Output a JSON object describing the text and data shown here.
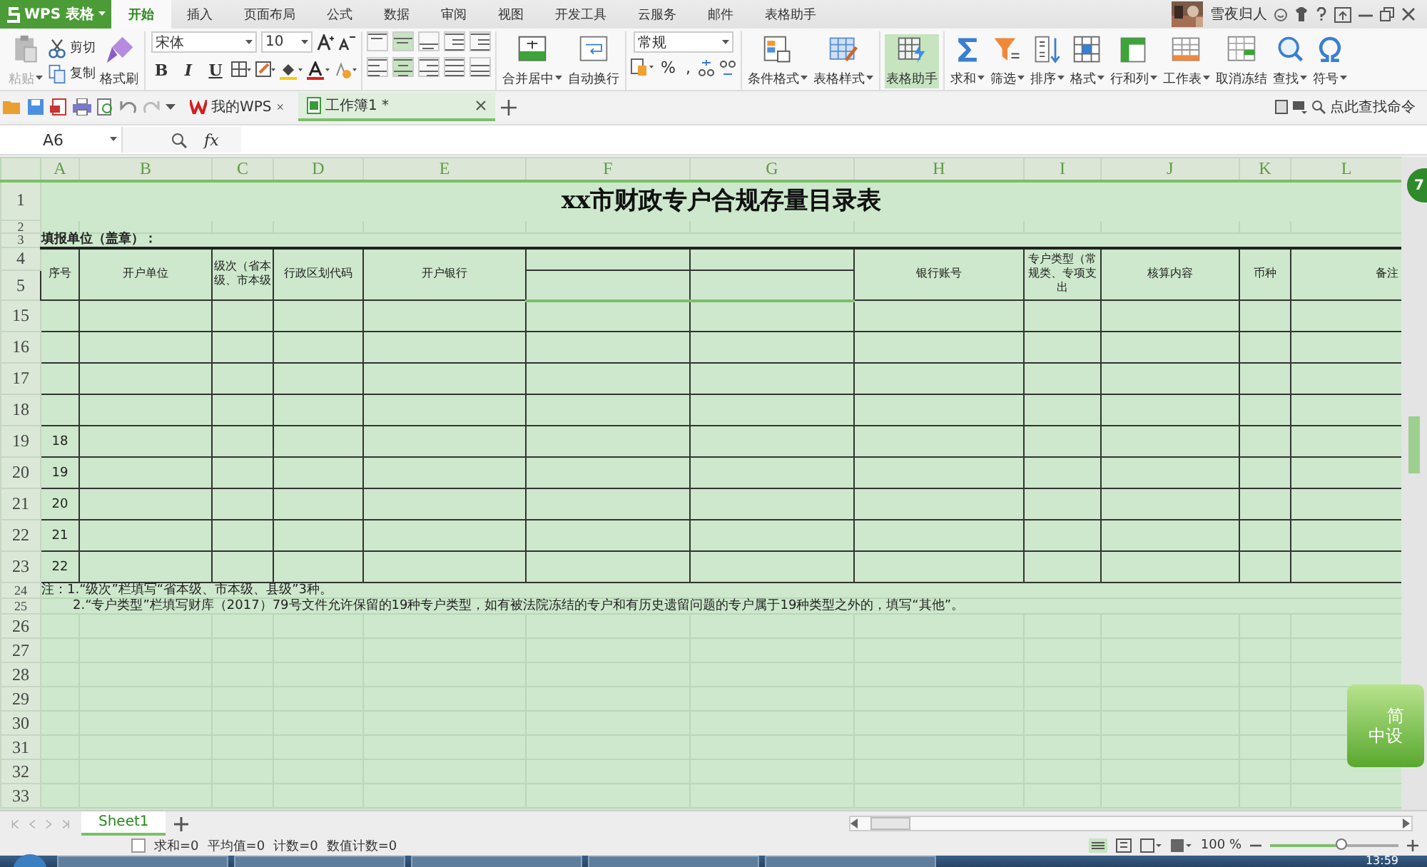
{
  "app": {
    "name": "WPS 表格"
  },
  "ribbon_tabs": [
    {
      "label": "开始",
      "selected": true
    },
    {
      "label": "插入",
      "selected": false
    },
    {
      "label": "页面布局",
      "selected": false
    },
    {
      "label": "公式",
      "selected": false
    },
    {
      "label": "数据",
      "selected": false
    },
    {
      "label": "审阅",
      "selected": false
    },
    {
      "label": "视图",
      "selected": false
    },
    {
      "label": "开发工具",
      "selected": false
    },
    {
      "label": "云服务",
      "selected": false
    },
    {
      "label": "邮件",
      "selected": false
    },
    {
      "label": "表格助手",
      "selected": false
    }
  ],
  "user": {
    "name": "雪夜归人"
  },
  "clipboard": [
    {
      "label": "粘贴",
      "disabled": true,
      "dropdown": true
    },
    {
      "label": "剪切",
      "disabled": false,
      "dropdown": false
    },
    {
      "label": "复制",
      "disabled": false,
      "dropdown": false
    },
    {
      "label": "格式刷",
      "disabled": false,
      "dropdown": false
    }
  ],
  "font": {
    "name": "宋体",
    "size": "10"
  },
  "text_styles": [
    "B",
    "I",
    "U"
  ],
  "align_buttons": [
    {
      "selected": false
    },
    {
      "selected": true
    },
    {
      "selected": false
    },
    {
      "selected": false
    },
    {
      "selected": false
    },
    {
      "selected": false
    },
    {
      "selected": true
    },
    {
      "selected": false
    },
    {
      "selected": false
    },
    {
      "selected": false
    }
  ],
  "merge_buttons": [
    {
      "label": "合并居中",
      "dropdown": true
    },
    {
      "label": "自动换行",
      "dropdown": false
    }
  ],
  "number_format": {
    "value": "常规",
    "symbols": [
      "%",
      ","
    ]
  },
  "large_buttons": [
    {
      "label": "条件格式",
      "dropdown": true,
      "selected": false
    },
    {
      "label": "表格样式",
      "dropdown": true,
      "selected": false
    },
    {
      "label": "表格助手",
      "dropdown": false,
      "selected": true
    },
    {
      "label": "求和",
      "dropdown": true,
      "selected": false
    },
    {
      "label": "筛选",
      "dropdown": true,
      "selected": false
    },
    {
      "label": "排序",
      "dropdown": true,
      "selected": false
    },
    {
      "label": "格式",
      "dropdown": true,
      "selected": false
    },
    {
      "label": "行和列",
      "dropdown": true,
      "selected": false
    },
    {
      "label": "工作表",
      "dropdown": true,
      "selected": false
    },
    {
      "label": "取消冻结",
      "dropdown": false,
      "selected": false
    },
    {
      "label": "查找",
      "dropdown": true,
      "selected": false
    },
    {
      "label": "符号",
      "dropdown": true,
      "selected": false
    }
  ],
  "doc_tabs": [
    {
      "label": "我的WPS",
      "kind": "home",
      "selected": false
    },
    {
      "label": "工作簿1 *",
      "kind": "sheet",
      "selected": true
    }
  ],
  "command_search": {
    "placeholder": "点此查找命令"
  },
  "name_box": {
    "value": "A6"
  },
  "formula_label": "fx",
  "columns": [
    "A",
    "B",
    "C",
    "D",
    "E",
    "F",
    "G",
    "H",
    "I",
    "J",
    "K",
    "L"
  ],
  "rows": [
    {
      "number": "1",
      "kind": "title",
      "text": "xx市财政专户合规存量目录表"
    },
    {
      "number": "2",
      "kind": "spacer"
    },
    {
      "number": "3",
      "kind": "unit",
      "text": "填报单位（盖章）："
    },
    {
      "numbers": [
        "4",
        "5"
      ],
      "kind": "header",
      "cells": [
        {
          "kind": "label",
          "text": "序号"
        },
        {
          "kind": "label",
          "text": "开户单位"
        },
        {
          "kind": "label",
          "text": "级次（省本级、市本级"
        },
        {
          "kind": "label",
          "text": "行政区划代码"
        },
        {
          "kind": "label",
          "text": "开户银行"
        },
        {
          "kind": "split"
        },
        {
          "kind": "split"
        },
        {
          "kind": "label",
          "text": "银行账号"
        },
        {
          "kind": "label",
          "text": "专户类型（常规类、专项支出"
        },
        {
          "kind": "label",
          "text": "核算内容"
        },
        {
          "kind": "label",
          "text": "币种"
        },
        {
          "kind": "label",
          "text": "备注"
        }
      ]
    },
    {
      "number": "15",
      "kind": "data"
    },
    {
      "number": "16",
      "kind": "data"
    },
    {
      "number": "17",
      "kind": "data"
    },
    {
      "number": "18",
      "kind": "data"
    },
    {
      "number": "19",
      "kind": "data",
      "serial": "18"
    },
    {
      "number": "20",
      "kind": "data",
      "serial": "19"
    },
    {
      "number": "21",
      "kind": "data",
      "serial": "20"
    },
    {
      "number": "22",
      "kind": "data",
      "serial": "21"
    },
    {
      "number": "23",
      "kind": "data",
      "serial": "22"
    },
    {
      "number": "24",
      "kind": "note",
      "text": "注：1.“级次”栏填写“省本级、市本级、县级”3种。"
    },
    {
      "number": "25",
      "kind": "note_indented",
      "text": "2.“专户类型”栏填写财库（2017）79号文件允许保留的19种专户类型，如有被法院冻结的专户和有历史遗留问题的专户属于19种类型之外的，填写“其他”。"
    },
    {
      "number": "26",
      "kind": "blank"
    },
    {
      "number": "27",
      "kind": "blank"
    },
    {
      "number": "28",
      "kind": "blank"
    },
    {
      "number": "29",
      "kind": "blank"
    },
    {
      "number": "30",
      "kind": "blank"
    },
    {
      "number": "31",
      "kind": "blank"
    },
    {
      "number": "32",
      "kind": "blank"
    },
    {
      "number": "33",
      "kind": "blank"
    }
  ],
  "sheet_tabs": [
    {
      "label": "Sheet1",
      "selected": true
    }
  ],
  "status_bar": {
    "stats": [
      "求和=0",
      "平均值=0",
      "计数=0",
      "数值计数=0"
    ],
    "zoom": "100 %",
    "zoom_level": {
      "level": 0.55
    }
  },
  "side_badge": "7",
  "ime_widget": {
    "top": "简",
    "bottom": "中设"
  },
  "taskbar": {
    "time": "13:59"
  }
}
